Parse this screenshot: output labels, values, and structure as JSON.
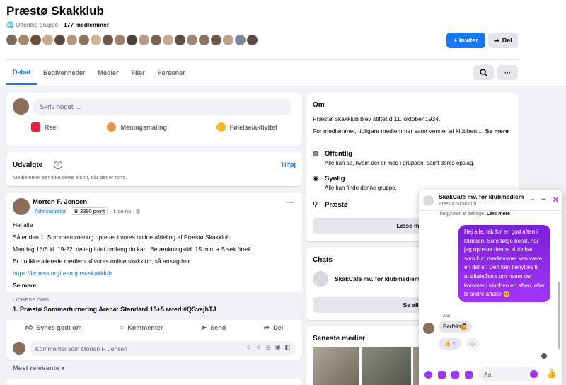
{
  "group": {
    "title": "Præstø Skakklub",
    "privacy": "Offentlig gruppe",
    "member_count": "177 medlemmer",
    "invite_label": "+ Inviter",
    "share_label": "Del"
  },
  "tabs": [
    {
      "label": "Debat"
    },
    {
      "label": "Begivenheder"
    },
    {
      "label": "Medier"
    },
    {
      "label": "Filer"
    },
    {
      "label": "Personer"
    }
  ],
  "composer": {
    "placeholder": "Skriv noget ...",
    "actions": [
      {
        "label": "Reel",
        "color": "#e41e3f"
      },
      {
        "label": "Meningsmåling",
        "color": "#f7923b"
      },
      {
        "label": "Følelse/aktivitet",
        "color": "#f7b928"
      }
    ]
  },
  "featured": {
    "title": "Udvalgte",
    "link": "Tilføj",
    "subtitle": "Medlemmer ser ikke dette afsnit, når det er tomt."
  },
  "post": {
    "author": "Morten F. Jensen",
    "badge": "Administrator",
    "points": "3390 point",
    "time": "· Lige nu ·",
    "lines": [
      "Hej alle",
      "Så er den 1. Sommerturnering oprettet i vores online afdeling af Præstø Skakklub.",
      "Mandag 16/6 kl. 19-22. deltag i det omfang du kan. Betænkningstid: 15 min. + 5 sek./træk",
      "Er du ikke allerede medlem af vores online skakklub, så ansøg her:"
    ],
    "link": "https://lichess.org/team/prst-skakklub",
    "see_more": "Se mere",
    "preview_domain": "LICHESS.ORG",
    "preview_title": "1. Præstø Sommerturnering Arena: Standard 15+5 rated #QSvejhTJ",
    "actions": [
      {
        "label": "Synes godt om"
      },
      {
        "label": "Kommenter"
      },
      {
        "label": "Send"
      },
      {
        "label": "Del"
      }
    ],
    "comment_placeholder": "Kommenter som Morten F. Jensen"
  },
  "sort_label": "Mest relevante",
  "about": {
    "title": "Om",
    "founded": "Præstø Skakklub blev stiftet d.11. oktober 1934.",
    "desc": "For medlemmer, tidligere medlemmer samt venner af klubben....",
    "see_more": "Se mere",
    "public_title": "Offentlig",
    "public_desc": "Alle kan se, hvem der er med i gruppen, samt deres opslag.",
    "visible_title": "Synlig",
    "visible_desc": "Alle kan finde denne gruppe.",
    "location": "Præstø",
    "learn_more": "Læse mere"
  },
  "chats": {
    "title": "Chats",
    "item": "SkakCafé mv. for klubmedlemmer",
    "see_all": "Se alle"
  },
  "media": {
    "title": "Seneste medier"
  },
  "chat_window": {
    "title": "SkakCafé mv. for klubmedlemmer",
    "subtitle": "Præstø Skakklub",
    "joined_text": "begynder at deltage.",
    "joined_more": "Læs mere",
    "outgoing": "Hej alle, tak for en god aften i klubben. Som følge heraf, har jeg oprettet denne klubchat, som kun medlemmer kan være en del af. Den kan benyttes til at aftale/høre om hvem der kommer i klubben en aften, eller til andre aftaler 😊",
    "sender": "Jan",
    "incoming": "Perfekt🙋",
    "reaction": "👍 1",
    "input_placeholder": "Aa"
  },
  "colors": {
    "accent": "#1877f2",
    "messenger": "#a334fa"
  }
}
